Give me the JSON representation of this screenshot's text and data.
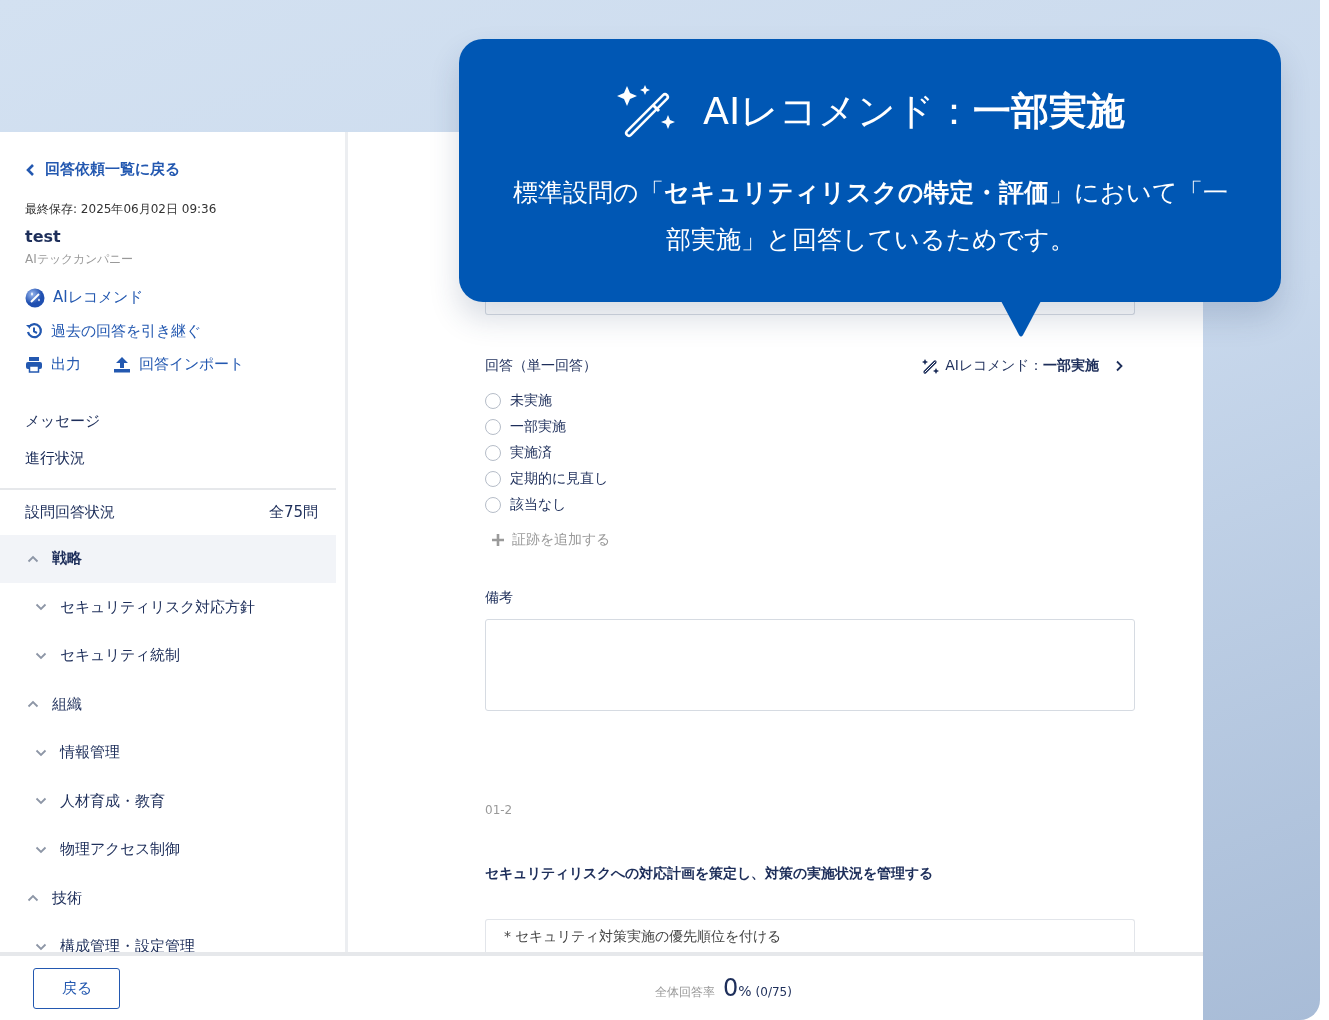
{
  "sidebar": {
    "back_link": "回答依頼一覧に戻る",
    "last_saved": "最終保存: 2025年06月02日 09:36",
    "title": "test",
    "company": "AIテックカンパニー",
    "actions": [
      {
        "kind": "ai",
        "label": "AIレコメンド"
      },
      {
        "kind": "history",
        "label": "過去の回答を引き継ぐ"
      }
    ],
    "tools": [
      {
        "kind": "print",
        "label": "出力"
      },
      {
        "kind": "upload",
        "label": "回答インポート"
      }
    ],
    "nav": [
      "メッセージ",
      "進行状況"
    ],
    "status": {
      "label": "設問回答状況",
      "count": "全75問"
    },
    "tree": [
      {
        "label": "戦略",
        "expanded": true,
        "selected": true,
        "children": [
          {
            "label": "セキュリティリスク対応方針",
            "expanded": false
          },
          {
            "label": "セキュリティ統制",
            "expanded": false
          }
        ]
      },
      {
        "label": "組織",
        "expanded": true,
        "selected": false,
        "children": [
          {
            "label": "情報管理",
            "expanded": false
          },
          {
            "label": "人材育成・教育",
            "expanded": false
          },
          {
            "label": "物理アクセス制御",
            "expanded": false
          }
        ]
      },
      {
        "label": "技術",
        "expanded": true,
        "selected": false,
        "children": [
          {
            "label": "構成管理・設定管理",
            "expanded": false
          }
        ]
      }
    ]
  },
  "tooltip": {
    "title": "AIレコメンド：**一部実施**",
    "body": "標準設問の「**セキュリティリスクの特定・評価**」において「一部実施」と回答しているためです。"
  },
  "answer": {
    "label": "回答（単一回答）",
    "recommend": "AIレコメンド：**一部実施**",
    "options": [
      {
        "label": "未実施",
        "selected": false
      },
      {
        "label": "一部実施",
        "selected": false
      },
      {
        "label": "実施済",
        "selected": false
      },
      {
        "label": "定期的に見直し",
        "selected": false
      },
      {
        "label": "該当なし",
        "selected": false
      }
    ],
    "add_evidence": "証跡を追加する"
  },
  "remarks": {
    "label": "備考"
  },
  "next_question": {
    "number": "01-2",
    "title": "セキュリティリスクへの対応計画を策定し、対策の実施状況を管理する",
    "hint": "* セキュリティ対策実施の優先順位を付ける"
  },
  "footer": {
    "back_button": "戻る",
    "rate_label": "全体回答率",
    "rate_value": "0",
    "rate_unit": "%",
    "rate_count": "(0/75)"
  }
}
